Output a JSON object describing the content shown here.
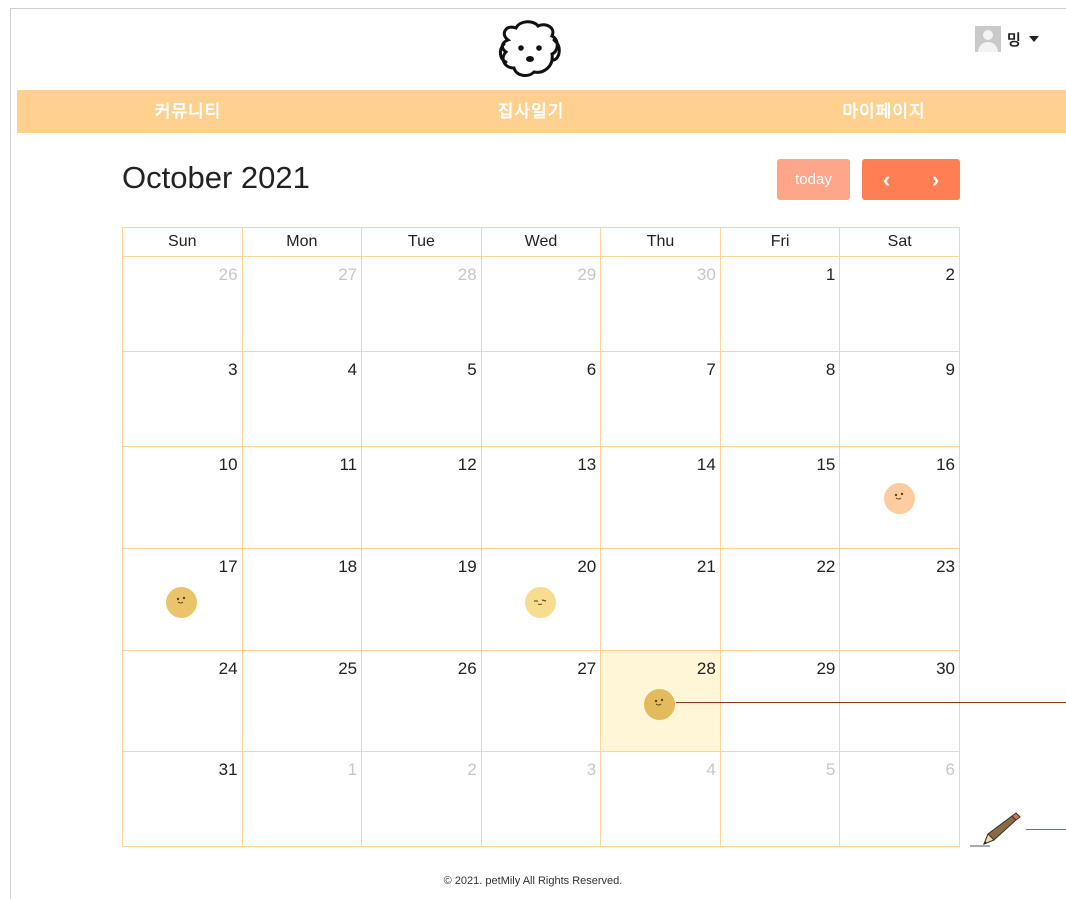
{
  "header": {
    "logo_icon": "dog-face-icon",
    "user_name": "밍",
    "avatar_icon": "user-avatar-icon"
  },
  "nav": {
    "items": [
      {
        "label": "커뮤니티"
      },
      {
        "label": "집사일기"
      },
      {
        "label": "마이페이지"
      }
    ]
  },
  "calendar": {
    "title": "October 2021",
    "today_label": "today",
    "prev_icon": "chevron-left-icon",
    "next_icon": "chevron-right-icon",
    "weekdays": [
      "Sun",
      "Mon",
      "Tue",
      "Wed",
      "Thu",
      "Fri",
      "Sat"
    ],
    "weeks": [
      [
        {
          "d": "26",
          "other": true
        },
        {
          "d": "27",
          "other": true
        },
        {
          "d": "28",
          "other": true
        },
        {
          "d": "29",
          "other": true
        },
        {
          "d": "30",
          "other": true
        },
        {
          "d": "1"
        },
        {
          "d": "2"
        }
      ],
      [
        {
          "d": "3"
        },
        {
          "d": "4"
        },
        {
          "d": "5"
        },
        {
          "d": "6"
        },
        {
          "d": "7"
        },
        {
          "d": "8"
        },
        {
          "d": "9"
        }
      ],
      [
        {
          "d": "10"
        },
        {
          "d": "11"
        },
        {
          "d": "12"
        },
        {
          "d": "13"
        },
        {
          "d": "14"
        },
        {
          "d": "15"
        },
        {
          "d": "16",
          "mood": "peach"
        }
      ],
      [
        {
          "d": "17",
          "mood": "yellow"
        },
        {
          "d": "18"
        },
        {
          "d": "19"
        },
        {
          "d": "20",
          "mood": "pale-yellow"
        },
        {
          "d": "21"
        },
        {
          "d": "22"
        },
        {
          "d": "23"
        }
      ],
      [
        {
          "d": "24"
        },
        {
          "d": "25"
        },
        {
          "d": "26"
        },
        {
          "d": "27"
        },
        {
          "d": "28",
          "mood": "gold",
          "today": true
        },
        {
          "d": "29"
        },
        {
          "d": "30"
        }
      ],
      [
        {
          "d": "31"
        },
        {
          "d": "1",
          "other": true
        },
        {
          "d": "2",
          "other": true
        },
        {
          "d": "3",
          "other": true
        },
        {
          "d": "4",
          "other": true
        },
        {
          "d": "5",
          "other": true
        },
        {
          "d": "6",
          "other": true
        }
      ]
    ]
  },
  "colors": {
    "nav_bg": "#ffd08e",
    "today_button": "#ffa68a",
    "arrow_buttons": "#ff7f55",
    "grid_border": "#ffd49a",
    "today_cell": "#fff6d8",
    "mood_peach": "#ffcca0",
    "mood_yellow": "#e9c46a",
    "mood_pale_yellow": "#f8dc8f",
    "mood_gold": "#e3bb5c"
  },
  "write_icon": "pencil-icon",
  "footer": {
    "text": "© 2021. petMily All Rights Reserved."
  }
}
